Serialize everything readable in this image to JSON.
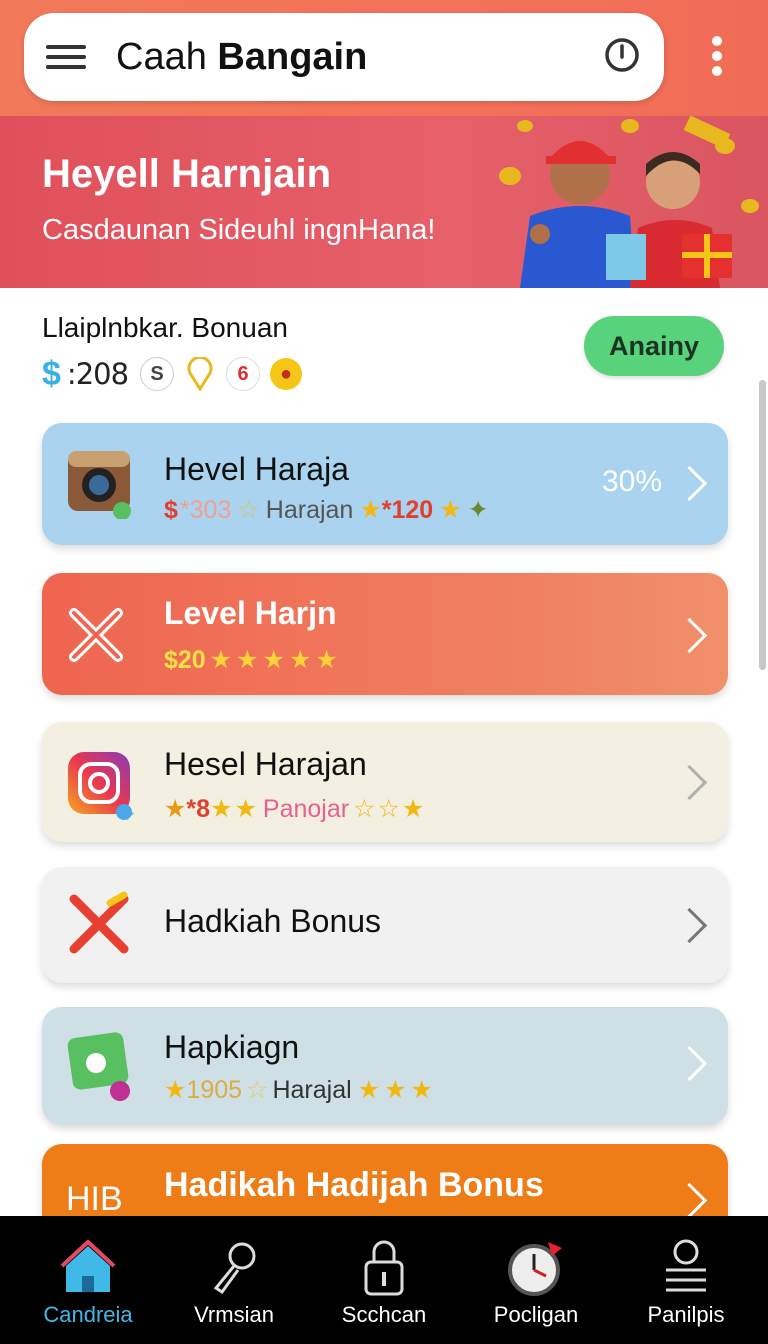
{
  "header": {
    "title_regular": "Caah ",
    "title_bold": "Bangain"
  },
  "banner": {
    "title": "Heyell Harnjain",
    "subtitle": "Casdaunan Sideuhl ingnHana!"
  },
  "bonus": {
    "label": "Llaiplnbkar. Bonuan",
    "currency": "$",
    "amount": ":208",
    "coin_s": "S",
    "coin_six": "6",
    "claim_label": "Anainy"
  },
  "cards": [
    {
      "title": "Hevel Haraja",
      "sub_a": "$",
      "sub_b": "*303",
      "sub_c": "Harajan",
      "sub_d": "*120",
      "percent": "30%",
      "icon": "camera-icon"
    },
    {
      "title": "Level Harjn",
      "sub_a": "$20",
      "icon": "cross-icon"
    },
    {
      "title": "Hesel Harajan",
      "sub_a": "*8",
      "sub_b": "Panojar",
      "icon": "instagram-icon"
    },
    {
      "title": "Hadkiah Bonus",
      "icon": "pencil-cross-icon"
    },
    {
      "title": "Hapkiagn",
      "sub_a": "1905",
      "sub_b": "Harajal",
      "icon": "photo-icon"
    },
    {
      "title": "Hadikah Hadijah Bonus",
      "icon_text": "HIB",
      "icon": "hib-icon"
    }
  ],
  "nav": [
    {
      "label": "Candreia",
      "icon": "home-icon",
      "active": true
    },
    {
      "label": "Vrmsian",
      "icon": "search-icon"
    },
    {
      "label": "Scchcan",
      "icon": "lock-icon"
    },
    {
      "label": "Pocligan",
      "icon": "clock-icon"
    },
    {
      "label": "Panilpis",
      "icon": "profile-icon"
    }
  ],
  "colors": {
    "header_bg": "#f27a5b",
    "banner_bg": "#e0505a",
    "claim_green": "#58d37c",
    "active_blue": "#40b8e8",
    "star_gold": "#f2b812"
  }
}
